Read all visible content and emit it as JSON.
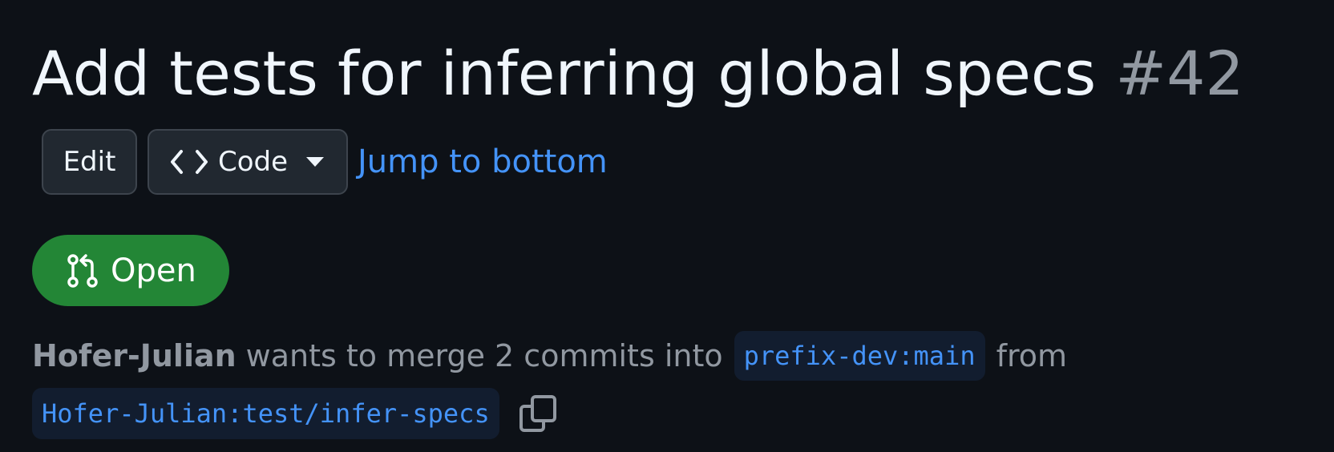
{
  "pull_request": {
    "title": "Add tests for inferring global specs",
    "number": "#42",
    "state": "Open",
    "author": "Hofer-Julian",
    "merge_text": "wants to merge 2 commits into",
    "base_branch": "prefix-dev:main",
    "from_text": "from",
    "head_branch": "Hofer-Julian:test/infer-specs"
  },
  "actions": {
    "edit_label": "Edit",
    "code_label": "Code",
    "jump_label": "Jump to bottom"
  },
  "icons": {
    "code": "code-icon",
    "caret": "caret-down-icon",
    "state": "git-pull-request-icon",
    "copy": "copy-icon"
  },
  "colors": {
    "background": "#0d1117",
    "title": "#f0f6fc",
    "muted": "#9198a1",
    "link": "#4493f8",
    "open_badge": "#238636",
    "button_bg": "#212830",
    "button_border": "#3d444d",
    "branch_bg": "#121d2f"
  }
}
